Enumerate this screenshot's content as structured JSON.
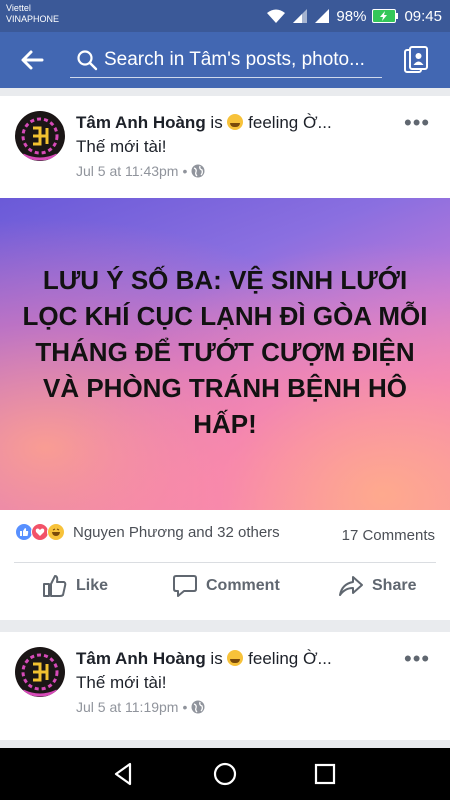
{
  "status_bar": {
    "carrier_top": "Viettel",
    "carrier_bottom": "VINAPHONE",
    "battery": "98%",
    "time": "09:45"
  },
  "search": {
    "placeholder": "Search in Tâm's posts, photo..."
  },
  "posts": [
    {
      "author": "Tâm Anh Hoàng",
      "verb": " is ",
      "feeling": " feeling Ờ...",
      "text": "Thế mới tài!",
      "time": "Jul 5 at 11:43pm",
      "separator": "•",
      "image_text": "LƯU Ý SỐ BA: VỆ SINH LƯỚI LỌC KHÍ CỤC LẠNH ĐÌ GÒA MỖI THÁNG ĐỂ TƯỚT CƯỢM ĐIỆN VÀ PHÒNG TRÁNH BỆNH HÔ HẤP!",
      "reactions_text": "Nguyen Phương and 32 others",
      "comments_count": "17 Comments",
      "actions": {
        "like": "Like",
        "comment": "Comment",
        "share": "Share"
      }
    },
    {
      "author": "Tâm Anh Hoàng",
      "verb": " is ",
      "feeling": " feeling Ờ...",
      "text": "Thế mới tài!",
      "time": "Jul 5 at 11:19pm",
      "separator": "•"
    }
  ],
  "colors": {
    "header_blue": "#4267b2",
    "status_blue": "#3b5998",
    "like_blue": "#5890ff",
    "love_red": "#f25268",
    "haha_yellow": "#f7c23a"
  }
}
